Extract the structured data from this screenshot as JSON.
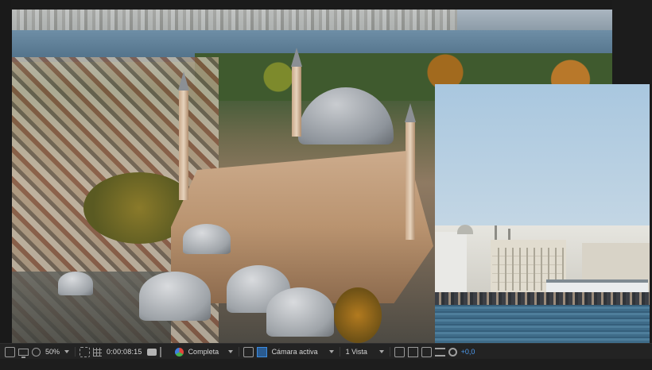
{
  "viewer": {
    "main_layer": "aerial-hagia-sophia-footage",
    "secondary_layer": "waterfront-footage"
  },
  "toolbar": {
    "zoom": "50%",
    "timecode": "0:00:08:15",
    "resolution": "Completa",
    "camera": "Cámara activa",
    "views": "1 Vista",
    "exposure": "+0,0",
    "icons": {
      "always_preview": "monitor-icon",
      "toggle_mask": "mask-icon",
      "fit": "fit-icon",
      "snapshot": "camera-icon",
      "channels": "rgb-icon",
      "region": "region-icon",
      "transparency": "checkerboard-icon",
      "fast_previews": "fast-preview-icon",
      "flowchart": "flowchart-icon",
      "reset_exposure": "exposure-icon"
    },
    "accent_color": "#4d9bf0"
  }
}
